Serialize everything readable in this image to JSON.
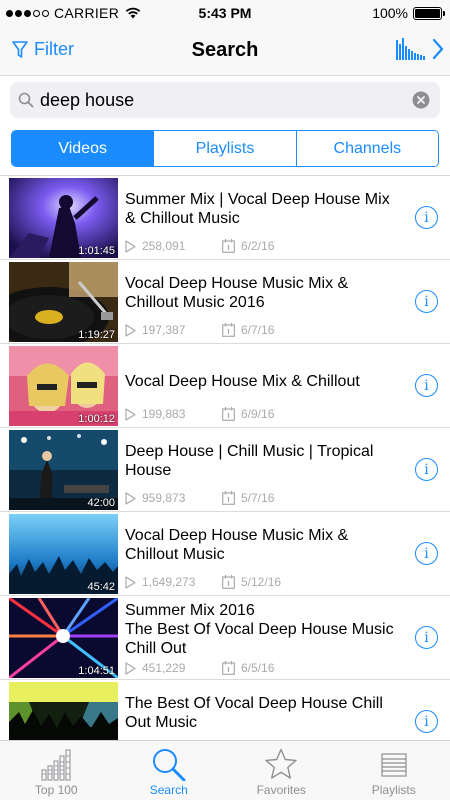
{
  "status_bar": {
    "carrier": "CARRIER",
    "time": "5:43 PM",
    "battery": "100%"
  },
  "nav": {
    "filter_label": "Filter",
    "title": "Search"
  },
  "search": {
    "query": "deep house"
  },
  "segments": [
    "Videos",
    "Playlists",
    "Channels"
  ],
  "videos": [
    {
      "title": "Summer Mix | Vocal Deep House Mix & Chillout Music",
      "duration": "1:01:45",
      "views": "258,091",
      "date": "6/2/16"
    },
    {
      "title": "Vocal Deep House Music Mix & Chillout Music 2016",
      "duration": "1:19:27",
      "views": "197,387",
      "date": "6/7/16"
    },
    {
      "title": "Vocal Deep House Mix & Chillout",
      "duration": "1:00:12",
      "views": "199,883",
      "date": "6/9/16"
    },
    {
      "title": "Deep House | Chill Music | Tropical House",
      "duration": "42:00",
      "views": "959,873",
      "date": "5/7/16"
    },
    {
      "title": "Vocal Deep House Music Mix & Chillout Music",
      "duration": "45:42",
      "views": "1,649,273",
      "date": "5/12/16"
    },
    {
      "title": "Summer Mix 2016\nThe Best Of Vocal Deep House Music Chill Out",
      "duration": "1:04:51",
      "views": "451,229",
      "date": "6/5/16"
    },
    {
      "title": "The Best Of Vocal Deep House Chill Out Music",
      "duration": "",
      "views": "",
      "date": ""
    }
  ],
  "tabs": [
    {
      "label": "Top 100",
      "icon": "bar-chart-icon"
    },
    {
      "label": "Search",
      "icon": "search-icon"
    },
    {
      "label": "Favorites",
      "icon": "star-icon"
    },
    {
      "label": "Playlists",
      "icon": "list-icon"
    }
  ],
  "colors": {
    "accent": "#1a8cff",
    "meta_text": "#aaaaaa"
  }
}
